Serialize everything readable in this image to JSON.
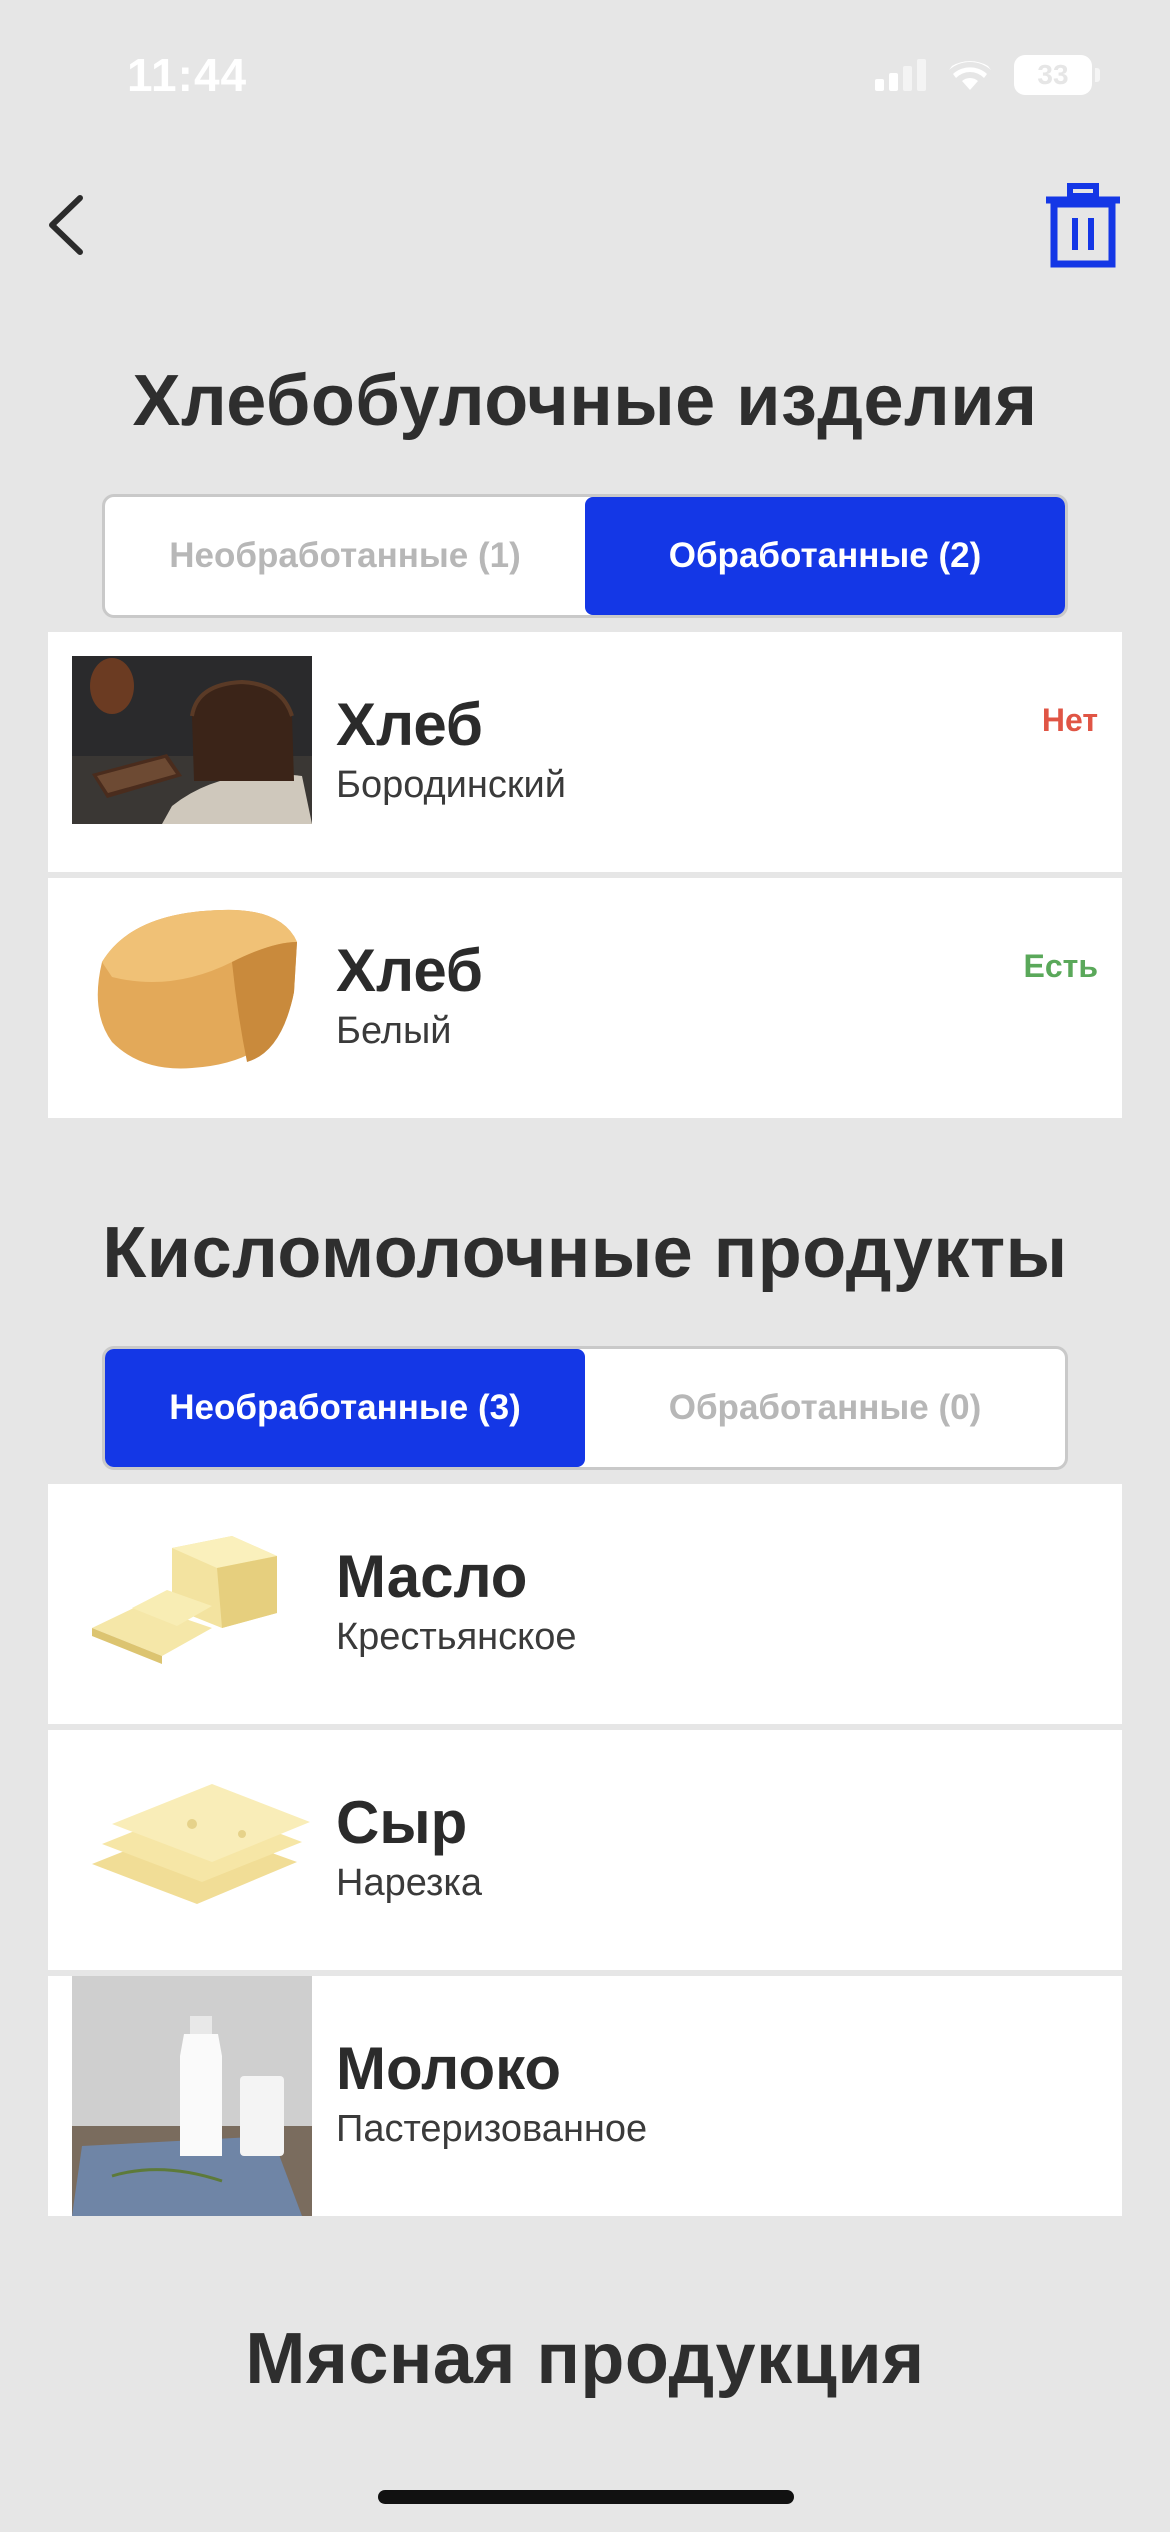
{
  "status_bar": {
    "time": "11:44",
    "battery": "33"
  },
  "nav": {
    "back_icon": "chevron-left-icon",
    "trash_icon": "trash-icon"
  },
  "colors": {
    "accent": "#1437e6",
    "status_no": "#e05545",
    "status_yes": "#5aa85a",
    "background": "#e6e6e6"
  },
  "sections": [
    {
      "title": "Хлебобулочные изделия",
      "tabs": [
        {
          "label": "Необработанные (1)",
          "active": false
        },
        {
          "label": "Обработанные (2)",
          "active": true
        }
      ],
      "items": [
        {
          "name": "Хлеб",
          "sub": "Бородинский",
          "status": "Нет",
          "image": "rye-bread-image"
        },
        {
          "name": "Хлеб",
          "sub": "Белый",
          "status": "Есть",
          "image": "white-bread-image"
        }
      ]
    },
    {
      "title": "Кисломолочные продукты",
      "tabs": [
        {
          "label": "Необработанные (3)",
          "active": true
        },
        {
          "label": "Обработанные (0)",
          "active": false
        }
      ],
      "items": [
        {
          "name": "Масло",
          "sub": "Крестьянское",
          "status": "",
          "image": "butter-image"
        },
        {
          "name": "Сыр",
          "sub": "Нарезка",
          "status": "",
          "image": "cheese-image"
        },
        {
          "name": "Молоко",
          "sub": "Пастеризованное",
          "status": "",
          "image": "milk-image"
        }
      ]
    },
    {
      "title": "Мясная продукция"
    }
  ]
}
